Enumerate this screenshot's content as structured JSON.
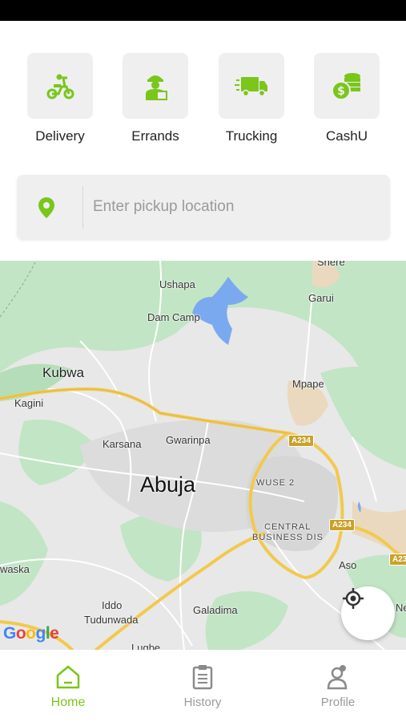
{
  "services": [
    {
      "label": "Delivery",
      "icon": "scooter-icon"
    },
    {
      "label": "Errands",
      "icon": "courier-icon"
    },
    {
      "label": "Trucking",
      "icon": "truck-icon"
    },
    {
      "label": "CashU",
      "icon": "coins-icon"
    }
  ],
  "pickup": {
    "placeholder": "Enter pickup location",
    "icon": "location-pin-icon"
  },
  "map": {
    "labels": {
      "shere": "Shere",
      "ushapa": "Ushapa",
      "garui": "Garui",
      "dam_camp": "Dam Camp",
      "kubwa": "Kubwa",
      "mpape": "Mpape",
      "kagini": "Kagini",
      "karsana": "Karsana",
      "gwarinpa": "Gwarinpa",
      "abuja": "Abuja",
      "wuse2": "WUSE 2",
      "cbd_line1": "CENTRAL",
      "cbd_line2": "BUSINESS DIS",
      "waska": "waska",
      "aso": "Aso",
      "iddo": "Iddo",
      "tudunwada": "Tudunwada",
      "galadima": "Galadima",
      "lugbe": "Lugbe",
      "ne": "Ne"
    },
    "road_badges": {
      "a234_1": "A234",
      "a234_2": "A234",
      "a23_edge": "A23"
    },
    "attribution": "Google",
    "locate_icon": "crosshair-icon"
  },
  "tabs": [
    {
      "label": "Home",
      "icon": "home-icon",
      "active": true
    },
    {
      "label": "History",
      "icon": "clipboard-icon",
      "active": false
    },
    {
      "label": "Profile",
      "icon": "user-icon",
      "active": false
    }
  ],
  "colors": {
    "accent": "#7ac61b",
    "tile_bg": "#efefef",
    "inactive": "#9a9a9a",
    "water": "#7ba9f0",
    "park": "#c2e5c5",
    "road": "#f2c94c"
  }
}
